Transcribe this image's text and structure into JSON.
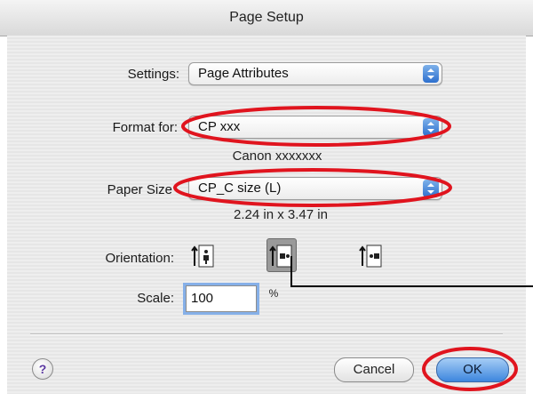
{
  "dialog": {
    "title": "Page Setup"
  },
  "settings": {
    "label": "Settings:",
    "value": "Page Attributes"
  },
  "format_for": {
    "label": "Format for:",
    "value": "CP xxx",
    "printer_name": "Canon xxxxxxx"
  },
  "paper_size": {
    "label": "Paper Size",
    "value": "CP_C size (L)",
    "dimensions": "2.24 in x 3.47 in"
  },
  "orientation": {
    "label": "Orientation:",
    "options": [
      "portrait-icon",
      "landscape-left-icon",
      "landscape-right-icon"
    ],
    "selected": "landscape-left-icon"
  },
  "scale": {
    "label": "Scale:",
    "value": "100",
    "unit": "%"
  },
  "buttons": {
    "help": "?",
    "cancel": "Cancel",
    "ok": "OK"
  },
  "colors": {
    "highlight_ring": "#e0141e",
    "selection_blue": "#3d86de",
    "focus_ring": "#86b0e8"
  }
}
